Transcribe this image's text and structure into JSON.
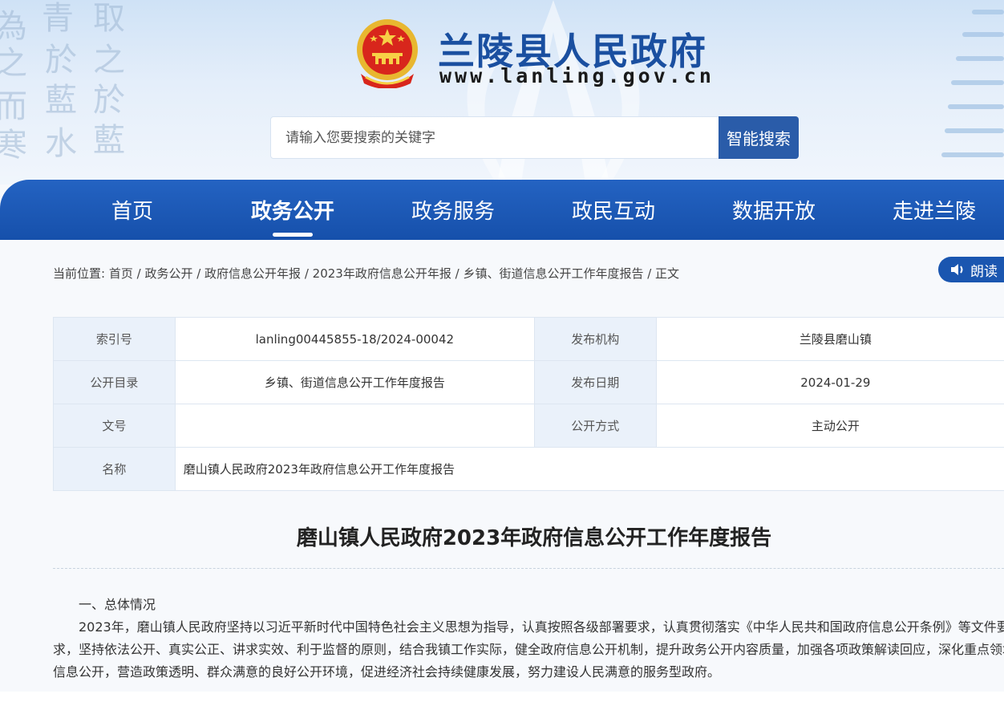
{
  "header": {
    "site_title": "兰陵县人民政府",
    "site_url": "www.lanling.gov.cn",
    "calligraphy": [
      "青",
      "取",
      "為",
      "於",
      "之",
      "之",
      "藍",
      "於",
      "而",
      "藍",
      "寒",
      "水"
    ]
  },
  "search": {
    "placeholder": "请输入您要搜索的关键字",
    "button_label": "智能搜索"
  },
  "nav": {
    "items": [
      "首页",
      "政务公开",
      "政务服务",
      "政民互动",
      "数据开放",
      "走进兰陵"
    ],
    "active_index": 1
  },
  "breadcrumb": {
    "prefix": "当前位置: ",
    "items": [
      "首页",
      "政务公开",
      "政府信息公开年报",
      "2023年政府信息公开年报",
      "乡镇、街道信息公开工作年度报告",
      "正文"
    ],
    "separator": " / "
  },
  "read_button": {
    "label": "朗读"
  },
  "meta": {
    "rows": [
      {
        "k1": "索引号",
        "v1": "lanling00445855-18/2024-00042",
        "k2": "发布机构",
        "v2": "兰陵县磨山镇"
      },
      {
        "k1": "公开目录",
        "v1": "乡镇、街道信息公开工作年度报告",
        "k2": "发布日期",
        "v2": "2024-01-29"
      },
      {
        "k1": "文号",
        "v1": "",
        "k2": "公开方式",
        "v2": "主动公开"
      }
    ],
    "name_label": "名称",
    "name_value": "磨山镇人民政府2023年政府信息公开工作年度报告"
  },
  "document": {
    "title": "磨山镇人民政府2023年政府信息公开工作年度报告",
    "paragraphs": [
      "　　一、总体情况",
      "　　2023年，磨山镇人民政府坚持以习近平新时代中国特色社会主义思想为指导，认真按照各级部署要求，认真贯彻落实《中华人民共和国政府信息公开条例》等文件要",
      "求，坚持依法公开、真实公正、讲求实效、利于监督的原则，结合我镇工作实际，健全政府信息公开机制，提升政务公开内容质量，加强各项政策解读回应，深化重点领域",
      "信息公开，营造政策透明、群众满意的良好公开环境，促进经济社会持续健康发展，努力建设人民满意的服务型政府。"
    ]
  },
  "colors": {
    "brand_blue": "#1a4fa0",
    "nav_blue": "#1650ab",
    "search_button": "#2a5ca9"
  }
}
